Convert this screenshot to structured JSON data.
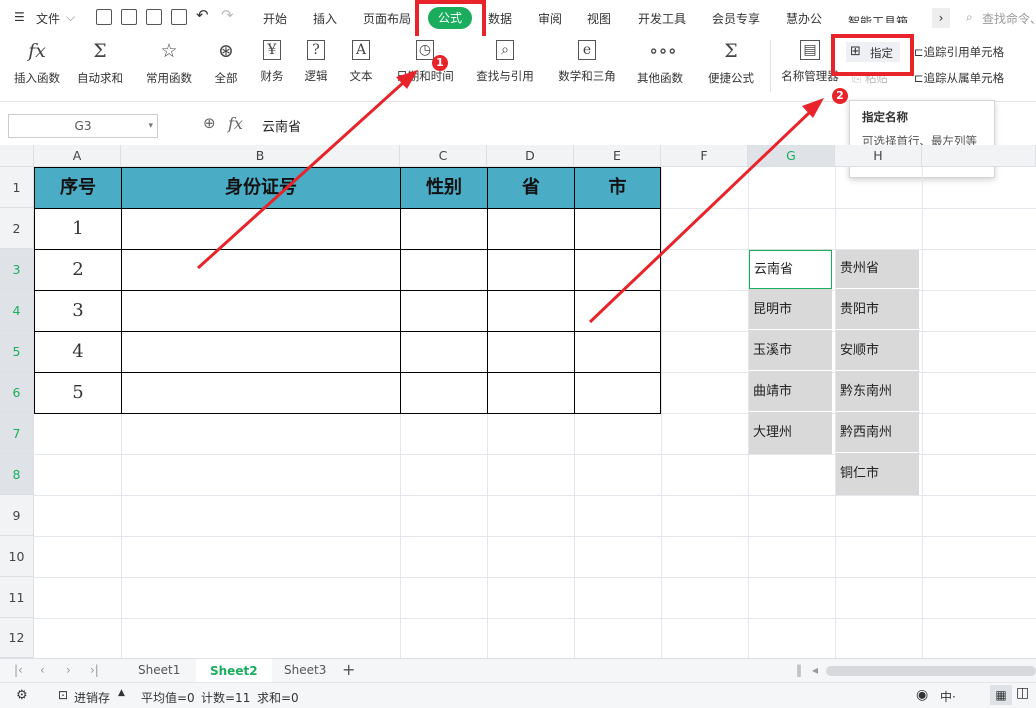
{
  "menu": {
    "file": "文件",
    "tabs": [
      "开始",
      "插入",
      "页面布局",
      "公式",
      "数据",
      "审阅",
      "视图",
      "开发工具",
      "会员专享",
      "慧办公",
      "智能工具箱"
    ],
    "active_tab": "公式",
    "search": "查找命令、"
  },
  "ribbon": {
    "buttons": [
      "插入函数",
      "自动求和",
      "常用函数",
      "全部",
      "财务",
      "逻辑",
      "文本",
      "日期和时间",
      "查找与引用",
      "数学和三角",
      "其他函数",
      "便捷公式",
      "名称管理器"
    ],
    "specify": "指定",
    "paste": "粘贴",
    "trace_precedents": "追踪引用单元格",
    "trace_dependents": "追踪从属单元格"
  },
  "formula_bar": {
    "name_box": "G3",
    "fx": "fx",
    "value": "云南省"
  },
  "tooltip": {
    "title": "指定名称",
    "body": "可选择首行、最左列等自动创建名称。"
  },
  "badges": [
    "1",
    "2"
  ],
  "columns": [
    "A",
    "B",
    "C",
    "D",
    "E",
    "F",
    "G",
    "H"
  ],
  "rows": [
    "1",
    "2",
    "3",
    "4",
    "5",
    "6",
    "7",
    "8",
    "9",
    "10",
    "11",
    "12"
  ],
  "table": {
    "headers": [
      "序号",
      "身份证号",
      "性别",
      "省",
      "市"
    ],
    "numbers": [
      "1",
      "2",
      "3",
      "4",
      "5"
    ]
  },
  "col_g": [
    "云南省",
    "昆明市",
    "玉溪市",
    "曲靖市",
    "大理州"
  ],
  "col_h": [
    "贵州省",
    "贵阳市",
    "安顺市",
    "黔东南州",
    "黔西南州",
    "铜仁市"
  ],
  "sheets": [
    "Sheet1",
    "Sheet2",
    "Sheet3"
  ],
  "active_sheet": "Sheet2",
  "status": {
    "macro": "进销存",
    "average": "平均值=0",
    "count": "计数=11",
    "sum": "求和=0"
  },
  "colors": {
    "accent": "#1aad5e",
    "header_fill": "#4bacc6",
    "highlight_red": "#e8232a",
    "gray_fill": "#d9d9d9"
  }
}
